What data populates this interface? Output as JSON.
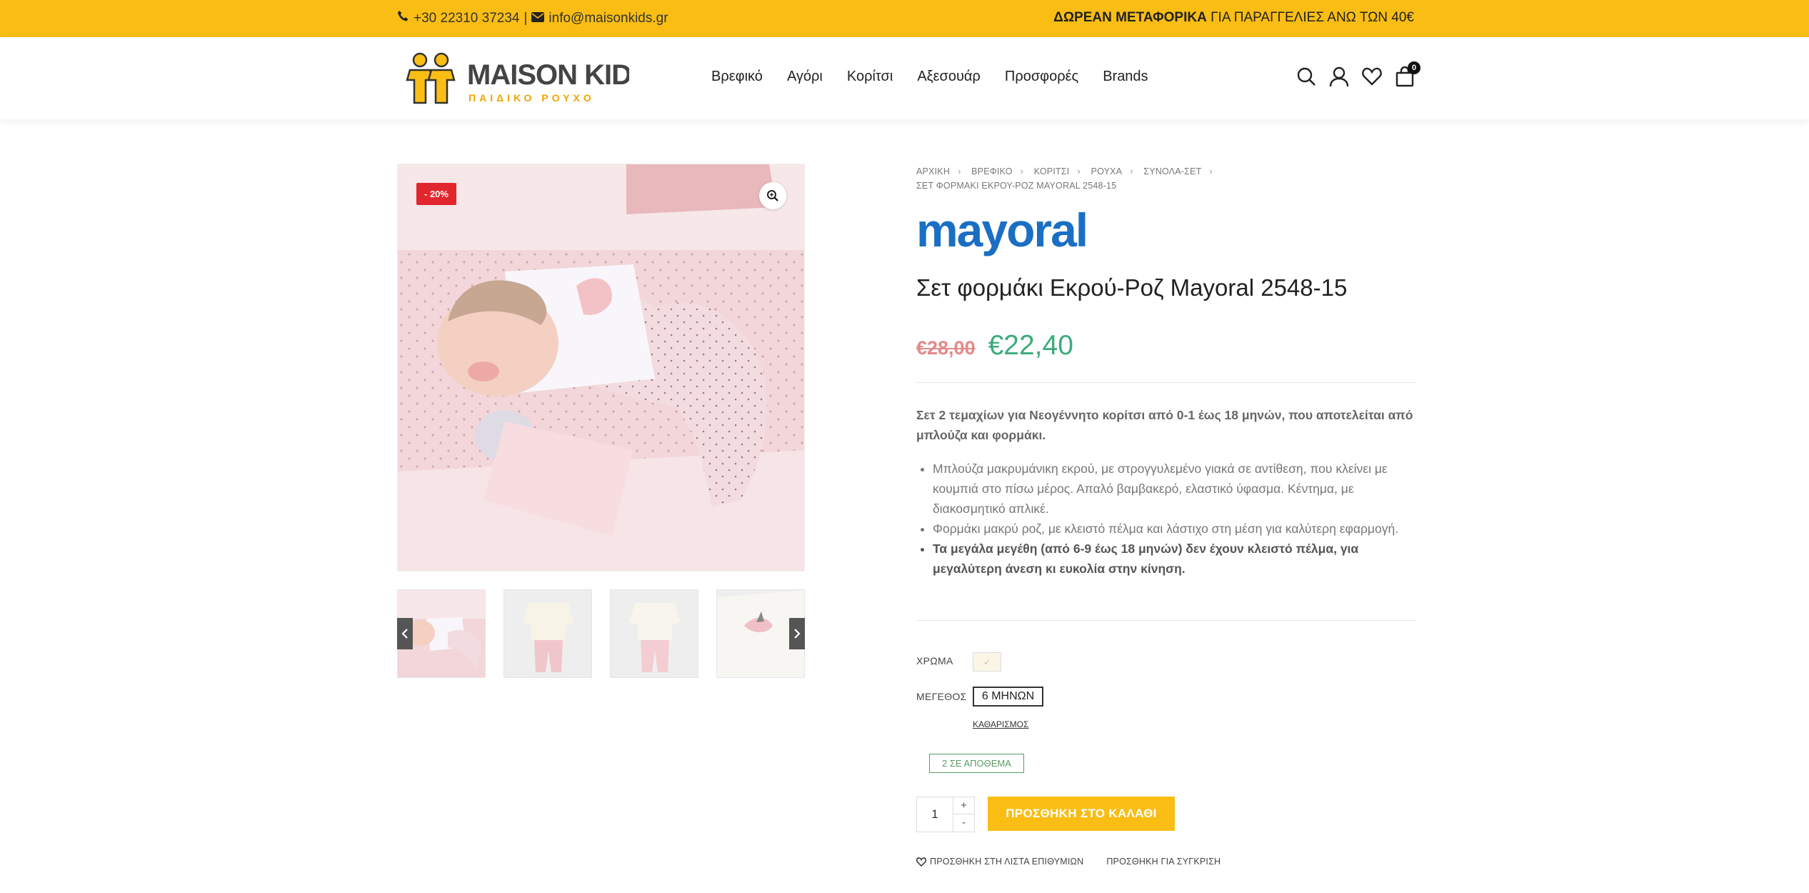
{
  "topbar": {
    "phone": "+30 22310 37234",
    "separator": "|",
    "email": "info@maisonkids.gr",
    "shipping_bold": "ΔΩΡΕΑΝ ΜΕΤΑΦΟΡΙΚΑ",
    "shipping_rest": "ΓΙΑ ΠΑΡΑΓΓΕΛΙΕΣ ΑΝΩ ΤΩΝ 40€"
  },
  "logo": {
    "name": "MAISON KIDS",
    "tagline": "ΠΑΙΔΙΚΟ ΡΟΥΧΟ"
  },
  "nav": [
    "Βρεφικό",
    "Αγόρι",
    "Κορίτσι",
    "Αξεσουάρ",
    "Προσφορές",
    "Brands"
  ],
  "header_icons": [
    "search-icon",
    "user-icon",
    "heart-icon",
    "bag-icon"
  ],
  "cart_count": "0",
  "gallery": {
    "sale_badge": "- 20%"
  },
  "breadcrumb": {
    "items": [
      "ΑΡΧΙΚΗ",
      "ΒΡΕΦΙΚΟ",
      "ΚΟΡΙΤΣΙ",
      "ΡΟΥΧΑ",
      "ΣΥΝΟΛΑ-ΣΕΤ"
    ],
    "current": "ΣΕΤ ΦΟΡΜΑΚΙ ΕΚΡΟΥ-ΡΟΖ MAYORAL 2548-15"
  },
  "brand": "mayoral",
  "product": {
    "title": "Σετ φορμάκι Εκρού-Ροζ Mayoral 2548-15",
    "old_price": "€28,00",
    "new_price": "€22,40",
    "description": "Σετ 2 τεμαχίων για Νεογέννητο κορίτσι από 0-1 έως 18 μηνών, που αποτελείται από μπλούζα και φορμάκι.",
    "bullets": [
      "Μπλούζα μακρυμάνικη εκρού, με στρογγυλεμένο γιακά σε αντίθεση, που κλείνει με κουμπιά στο πίσω μέρος. Απαλό βαμβακερό, ελαστικό ύφασμα. Κέντημα, με διακοσμητικό απλικέ.",
      "Φορμάκι μακρύ ροζ, με κλειστό πέλμα και λάστιχο στη μέση για καλύτερη εφαρμογή."
    ],
    "bullet_bold": "Τα μεγάλα μεγέθη (από 6-9 έως 18 μηνών) δεν έχουν κλειστό πέλμα, για μεγαλύτερη άνεση κι ευκολία στην κίνηση."
  },
  "options": {
    "color_label": "ΧΡΩΜΑ",
    "size_label": "ΜΕΓΕΘΟΣ",
    "size_value": "6 ΜΗΝΩΝ",
    "clear": "ΚΑΘΑΡΙΣΜΟΣ",
    "stock": "2 ΣΕ ΑΠΟΘΕΜΑ"
  },
  "cart": {
    "qty": "1",
    "plus": "+",
    "minus": "-",
    "add_label": "ΠΡΟΣΘΗΚΗ ΣΤΟ ΚΑΛΑΘΙ"
  },
  "links": {
    "wishlist": "ΠΡΟΣΘΗΚΗ ΣΤΗ ΛΙΣΤΑ ΕΠΙΘΥΜΙΩΝ",
    "compare": "ΠΡΟΣΘΗΚΗ ΓΙΑ ΣΥΓΚΡΙΣΗ"
  },
  "colors": {
    "accent": "#f9bd14",
    "sale": "#e2262e",
    "price": "#3cab7a",
    "brand_blue": "#1a6fc4",
    "stock": "#5a9b62"
  }
}
